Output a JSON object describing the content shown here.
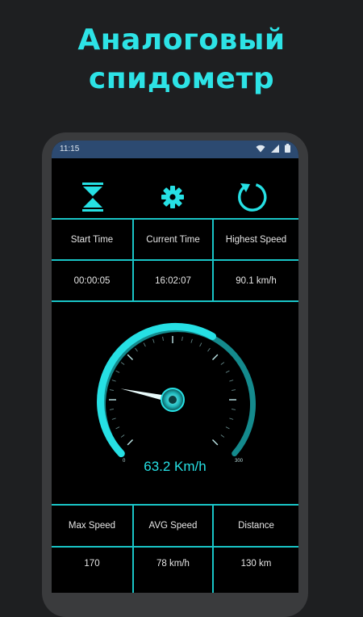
{
  "promo": {
    "line1": "Аналоговый",
    "line2": "спидометр"
  },
  "status_bar": {
    "time": "11:15",
    "icons": [
      "wifi-icon",
      "signal-icon",
      "battery-icon"
    ]
  },
  "toolbar": {
    "icons": [
      "hourglass-icon",
      "gear-icon",
      "refresh-icon"
    ]
  },
  "stats_top": {
    "headers": [
      "Start Time",
      "Current Time",
      "Highest Speed"
    ],
    "values": [
      "00:00:05",
      "16:02:07",
      "90.1 km/h"
    ]
  },
  "gauge": {
    "speed_text": "63.2 Km/h",
    "scale_min": "0",
    "scale_max": "300",
    "speed_fraction": 0.211
  },
  "stats_bottom": {
    "headers": [
      "Max Speed",
      "AVG Speed",
      "Distance"
    ],
    "values": [
      "170",
      "78 km/h",
      "130 km"
    ]
  },
  "colors": {
    "accent": "#26e0e4",
    "grid": "#19c4c6",
    "status_bar": "#2c4a71",
    "background": "#1e1f21"
  }
}
